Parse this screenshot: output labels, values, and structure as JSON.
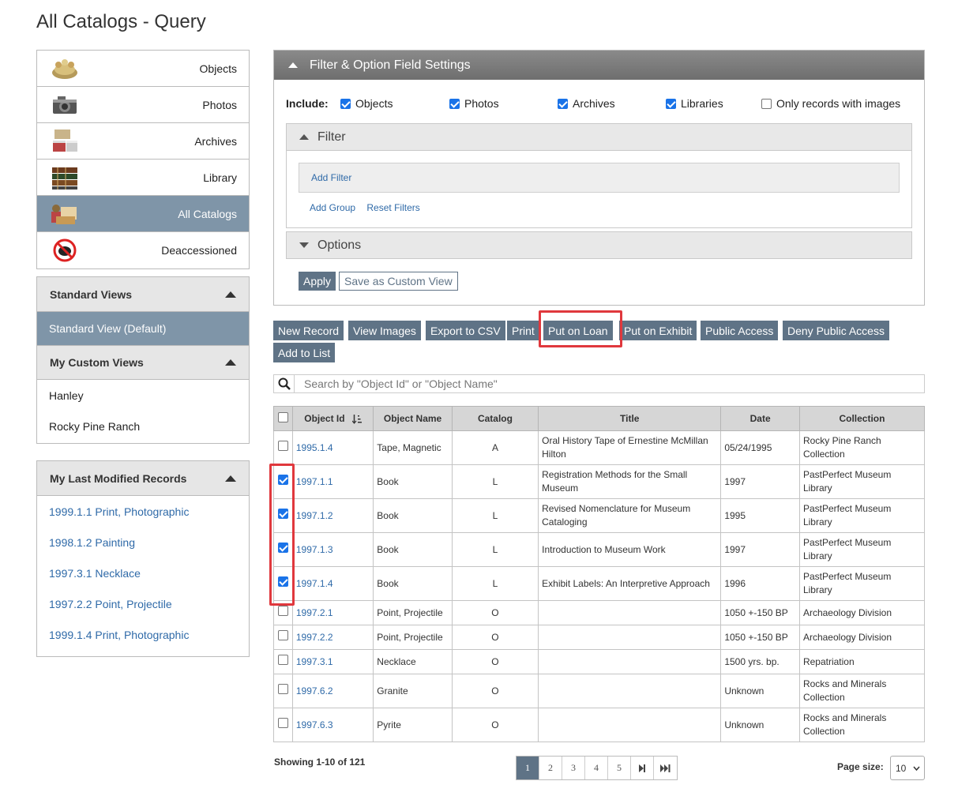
{
  "page": {
    "title": "All Catalogs - Query"
  },
  "catalogs": [
    {
      "label": "Objects",
      "icon": "objects-icon"
    },
    {
      "label": "Photos",
      "icon": "camera-icon"
    },
    {
      "label": "Archives",
      "icon": "archive-boxes-icon"
    },
    {
      "label": "Library",
      "icon": "books-icon"
    },
    {
      "label": "All Catalogs",
      "icon": "all-catalogs-icon",
      "active": true
    },
    {
      "label": "Deaccessioned",
      "icon": "deaccessioned-icon"
    }
  ],
  "standard_views": {
    "header": "Standard Views",
    "items": [
      "Standard View (Default)"
    ]
  },
  "custom_views": {
    "header": "My Custom Views",
    "items": [
      "Hanley",
      "Rocky Pine Ranch"
    ]
  },
  "last_modified": {
    "header": "My Last Modified Records",
    "items": [
      "1999.1.1 Print, Photographic",
      "1998.1.2 Painting",
      "1997.3.1 Necklace",
      "1997.2.2 Point, Projectile",
      "1999.1.4 Print, Photographic"
    ]
  },
  "filter_settings": {
    "header": "Filter & Option Field Settings",
    "include_label": "Include:",
    "include_options": [
      {
        "label": "Objects",
        "checked": true
      },
      {
        "label": "Photos",
        "checked": true
      },
      {
        "label": "Archives",
        "checked": true
      },
      {
        "label": "Libraries",
        "checked": true
      },
      {
        "label": "Only records with images",
        "checked": false
      }
    ],
    "filter_header": "Filter",
    "add_filter": "Add Filter",
    "add_group": "Add Group",
    "reset_filters": "Reset Filters",
    "options_header": "Options",
    "apply": "Apply",
    "save_custom_view": "Save as Custom View"
  },
  "actions": [
    "New Record",
    "View Images",
    "Export to CSV",
    "Print",
    "Put on Loan",
    "Put on Exhibit",
    "Public Access",
    "Deny Public Access",
    "Add to List"
  ],
  "search": {
    "placeholder": "Search by \"Object Id\" or \"Object Name\"",
    "value": ""
  },
  "table": {
    "columns": [
      "Object Id",
      "Object Name",
      "Catalog",
      "Title",
      "Date",
      "Collection"
    ],
    "rows": [
      {
        "id": "1995.1.4",
        "name": "Tape, Magnetic",
        "catalog": "A",
        "title": "Oral History Tape of Ernestine McMillan Hilton",
        "date": "05/24/1995",
        "collection": "Rocky Pine Ranch Collection",
        "checked": false
      },
      {
        "id": "1997.1.1",
        "name": "Book",
        "catalog": "L",
        "title": "Registration Methods for the Small Museum",
        "date": "1997",
        "collection": "PastPerfect Museum Library",
        "checked": true
      },
      {
        "id": "1997.1.2",
        "name": "Book",
        "catalog": "L",
        "title": "Revised Nomenclature for Museum Cataloging",
        "date": "1995",
        "collection": "PastPerfect Museum Library",
        "checked": true
      },
      {
        "id": "1997.1.3",
        "name": "Book",
        "catalog": "L",
        "title": "Introduction to Museum Work",
        "date": "1997",
        "collection": "PastPerfect Museum Library",
        "checked": true
      },
      {
        "id": "1997.1.4",
        "name": "Book",
        "catalog": "L",
        "title": "Exhibit Labels: An Interpretive Approach",
        "date": "1996",
        "collection": "PastPerfect Museum Library",
        "checked": true
      },
      {
        "id": "1997.2.1",
        "name": "Point, Projectile",
        "catalog": "O",
        "title": "",
        "date": "1050 +-150 BP",
        "collection": "Archaeology Division",
        "checked": false
      },
      {
        "id": "1997.2.2",
        "name": "Point, Projectile",
        "catalog": "O",
        "title": "",
        "date": "1050 +-150 BP",
        "collection": "Archaeology Division",
        "checked": false
      },
      {
        "id": "1997.3.1",
        "name": "Necklace",
        "catalog": "O",
        "title": "",
        "date": "1500 yrs. bp.",
        "collection": "Repatriation",
        "checked": false
      },
      {
        "id": "1997.6.2",
        "name": "Granite",
        "catalog": "O",
        "title": "",
        "date": "Unknown",
        "collection": "Rocks and Minerals Collection",
        "checked": false
      },
      {
        "id": "1997.6.3",
        "name": "Pyrite",
        "catalog": "O",
        "title": "",
        "date": "Unknown",
        "collection": "Rocks and Minerals Collection",
        "checked": false
      }
    ]
  },
  "footer": {
    "showing": "Showing 1-10 of 121",
    "pages": [
      "1",
      "2",
      "3",
      "4",
      "5"
    ],
    "current_page": "1",
    "page_size_label": "Page size:",
    "page_size": "10"
  },
  "colors": {
    "accent": "#5f7386",
    "highlight": "#e0383d",
    "link": "#2f6aa8",
    "active_nav": "#7f95a8"
  }
}
